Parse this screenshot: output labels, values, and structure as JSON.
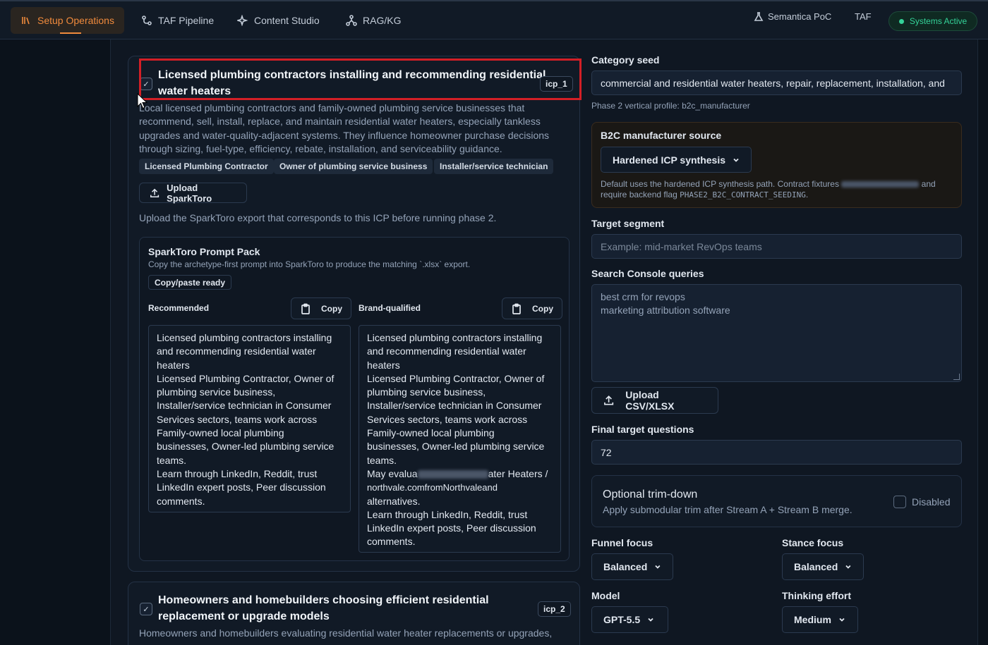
{
  "nav": {
    "tabs": [
      {
        "label": "Setup Operations",
        "icon": "library-icon",
        "active": true
      },
      {
        "label": "TAF Pipeline",
        "icon": "workflow-icon"
      },
      {
        "label": "Content Studio",
        "icon": "sparkles-icon"
      },
      {
        "label": "RAG/KG",
        "icon": "network-icon"
      }
    ],
    "right": {
      "poc_label": "Semantica PoC",
      "taf_label": "TAF",
      "status_label": "Systems Active"
    }
  },
  "icp1": {
    "title_line1": "Licensed plumbing contractors installing and recommending residential",
    "title_line2": "water heaters",
    "badge": "icp_1",
    "desc": [
      "Local licensed plumbing contractors and family-owned plumbing service businesses that",
      "recommend, sell, install, replace, and maintain residential water heaters, especially tankless",
      "upgrades and water-quality-adjacent systems. They influence homeowner purchase decisions",
      "through sizing, fuel-type, efficiency, rebate, installation, and serviceability guidance."
    ],
    "tags": [
      "Licensed Plumbing Contractor",
      "Owner of plumbing service business",
      "Installer/service technician"
    ],
    "upload_label": "Upload SparkToro",
    "upload_hint": "Upload the SparkToro export that corresponds to this ICP before running phase 2."
  },
  "pack": {
    "title": "SparkToro Prompt Pack",
    "subtitle": "Copy the archetype-first prompt into SparkToro to produce the matching `.xlsx` export.",
    "chip": "Copy/paste ready",
    "recommended_label": "Recommended",
    "brand_label": "Brand-qualified",
    "copy_label": "Copy",
    "recommended_lines": [
      "Licensed plumbing contractors installing",
      "and recommending residential water",
      "heaters",
      "Licensed Plumbing Contractor, Owner of",
      "plumbing service business,",
      "Installer/service technician in Consumer",
      "Services sectors, teams work across",
      "Family-owned local plumbing",
      "businesses, Owner-led plumbing service",
      "teams.",
      "Learn through LinkedIn, Reddit, trust",
      "LinkedIn expert posts, Peer discussion",
      "comments."
    ],
    "brand_lines_a": [
      "Licensed plumbing contractors installing",
      "and recommending residential water",
      "heaters",
      "Licensed Plumbing Contractor, Owner of",
      "plumbing service business,",
      "Installer/service technician in Consumer",
      "Services sectors, teams work across",
      "Family-owned local plumbing",
      "businesses, Owner-led plumbing service",
      "teams."
    ],
    "brand_may_prefix": "May evalua",
    "brand_may_suffix": "ater Heaters /",
    "brand_domain_line": "northvale.comfromNorthvaleand",
    "brand_lines_b": [
      "alternatives.",
      "Learn through LinkedIn, Reddit, trust",
      "LinkedIn expert posts, Peer discussion",
      "comments."
    ]
  },
  "icp2": {
    "title_line1": "Homeowners and homebuilders choosing efficient residential",
    "title_line2": "replacement or upgrade models",
    "badge": "icp_2",
    "desc": "Homeowners and homebuilders evaluating residential water heater replacements or upgrades,"
  },
  "right": {
    "category_seed_label": "Category seed",
    "category_seed_value": "commercial and residential water heaters, repair, replacement, installation, and",
    "vertical_hint": "Phase 2 vertical profile: b2c_manufacturer",
    "b2c_label": "B2C manufacturer source",
    "b2c_select": "Hardened ICP synthesis",
    "b2c_note1_prefix": "Default uses the hardened ICP synthesis path. Contract fixtures",
    "b2c_note1_suffix": "and",
    "b2c_note2_prefix": "require backend flag",
    "b2c_flag": "PHASE2_B2C_CONTRACT_SEEDING",
    "target_segment_label": "Target segment",
    "target_segment_placeholder": "Example: mid-market RevOps teams",
    "search_console_label": "Search Console queries",
    "search_console_lines": [
      "best crm for revops",
      "marketing attribution software"
    ],
    "upload_csv_label": "Upload CSV/XLSX",
    "final_questions_label": "Final target questions",
    "final_questions_value": "72",
    "trim_title": "Optional trim-down",
    "trim_desc": "Apply submodular trim after Stream A + Stream B merge.",
    "trim_toggle_label": "Disabled",
    "funnel_label": "Funnel focus",
    "funnel_value": "Balanced",
    "stance_label": "Stance focus",
    "stance_value": "Balanced",
    "model_label": "Model",
    "model_value": "GPT-5.5",
    "thinking_label": "Thinking effort",
    "thinking_value": "Medium"
  }
}
